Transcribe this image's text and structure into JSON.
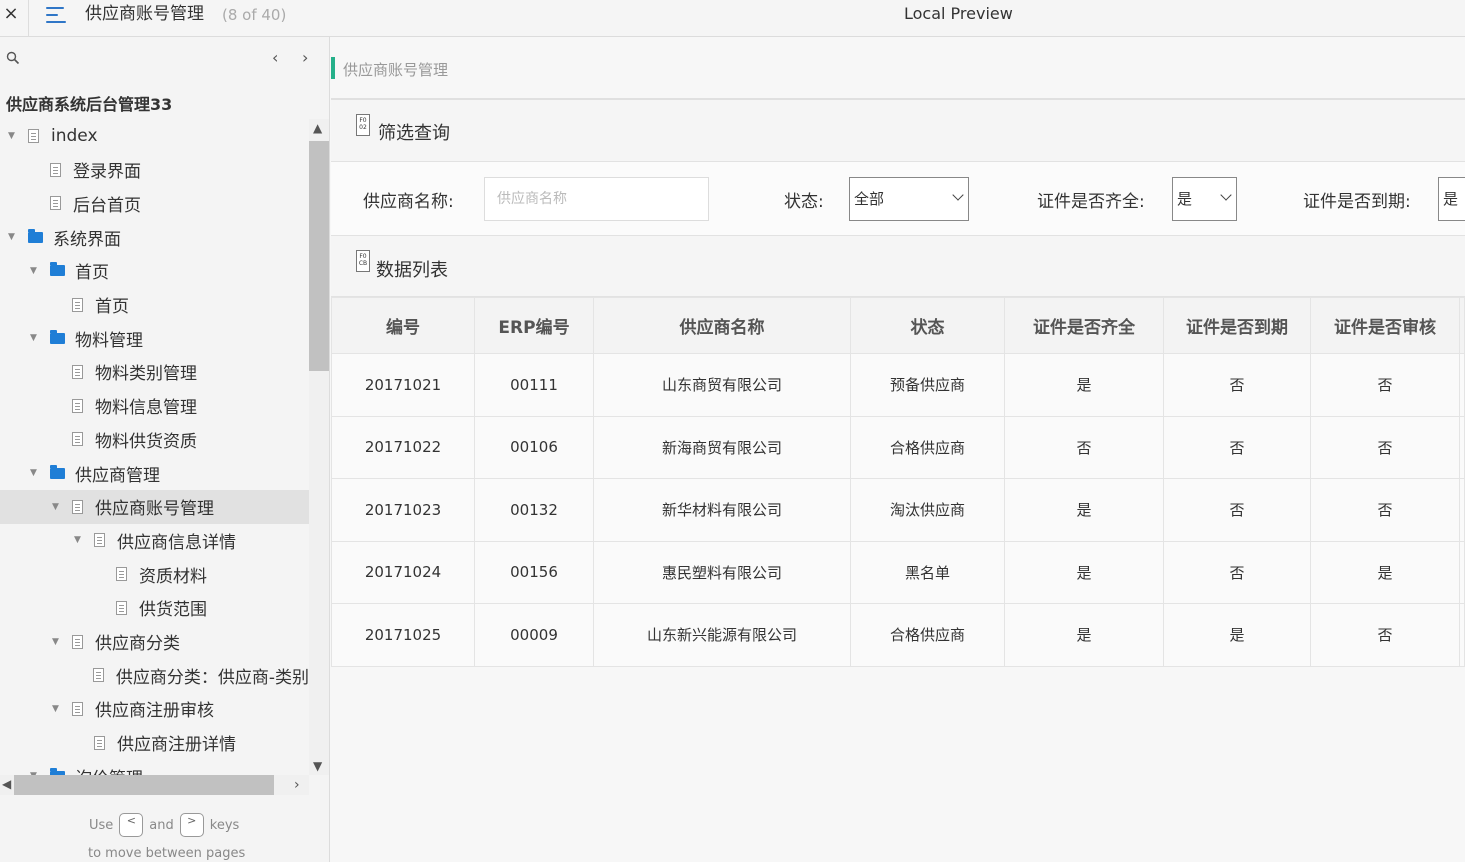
{
  "topbar": {
    "close_icon": "×",
    "page_title": "供应商账号管理",
    "page_count": "(8 of 40)",
    "preview_title": "Local Preview"
  },
  "sidebar": {
    "project_title": "供应商系统后台管理33",
    "tree": [
      {
        "label": "index",
        "type": "page",
        "level": 0,
        "expanded": true
      },
      {
        "label": "登录界面",
        "type": "page",
        "level": 1
      },
      {
        "label": "后台首页",
        "type": "page",
        "level": 1
      },
      {
        "label": "系统界面",
        "type": "folder",
        "level": 0,
        "expanded": true
      },
      {
        "label": "首页",
        "type": "folder",
        "level": 1,
        "expanded": true
      },
      {
        "label": "首页",
        "type": "page",
        "level": 2
      },
      {
        "label": "物料管理",
        "type": "folder",
        "level": 1,
        "expanded": true
      },
      {
        "label": "物料类别管理",
        "type": "page",
        "level": 2
      },
      {
        "label": "物料信息管理",
        "type": "page",
        "level": 2
      },
      {
        "label": "物料供货资质",
        "type": "page",
        "level": 2
      },
      {
        "label": "供应商管理",
        "type": "folder",
        "level": 1,
        "expanded": true
      },
      {
        "label": "供应商账号管理",
        "type": "page",
        "level": 2,
        "expanded": true,
        "selected": true
      },
      {
        "label": "供应商信息详情",
        "type": "page",
        "level": 3,
        "expanded": true
      },
      {
        "label": "资质材料",
        "type": "page",
        "level": 4
      },
      {
        "label": "供货范围",
        "type": "page",
        "level": 4
      },
      {
        "label": "供应商分类",
        "type": "page",
        "level": 2,
        "expanded": true
      },
      {
        "label": "供应商分类：供应商-类别",
        "type": "page",
        "level": 3
      },
      {
        "label": "供应商注册审核",
        "type": "page",
        "level": 2,
        "expanded": true
      },
      {
        "label": "供应商注册详情",
        "type": "page",
        "level": 3
      },
      {
        "label": "询价管理",
        "type": "folder",
        "level": 1,
        "expanded": true
      }
    ],
    "keys_hint": {
      "use": "Use",
      "prev_key": "<",
      "and": "and",
      "next_key": ">",
      "keys": "keys",
      "line2": "to move between pages"
    }
  },
  "main": {
    "breadcrumb": "供应商账号管理",
    "filter_section": {
      "icon_text": "F0 02",
      "title": "筛选查询"
    },
    "filters": {
      "name_label": "供应商名称:",
      "name_placeholder": "供应商名称",
      "status_label": "状态:",
      "status_value": "全部",
      "cert_complete_label": "证件是否齐全:",
      "cert_complete_value": "是",
      "cert_expired_label": "证件是否到期:",
      "cert_expired_value": "是"
    },
    "list_section": {
      "icon_text": "F0 CB",
      "title": "数据列表"
    },
    "table": {
      "columns": [
        "编号",
        "ERP编号",
        "供应商名称",
        "状态",
        "证件是否齐全",
        "证件是否到期",
        "证件是否审核"
      ],
      "rows": [
        [
          "20171021",
          "00111",
          "山东商贸有限公司",
          "预备供应商",
          "是",
          "否",
          "否"
        ],
        [
          "20171022",
          "00106",
          "新海商贸有限公司",
          "合格供应商",
          "否",
          "否",
          "否"
        ],
        [
          "20171023",
          "00132",
          "新华材料有限公司",
          "淘汰供应商",
          "是",
          "否",
          "否"
        ],
        [
          "20171024",
          "00156",
          "惠民塑料有限公司",
          "黑名单",
          "是",
          "否",
          "是"
        ],
        [
          "20171025",
          "00009",
          "山东新兴能源有限公司",
          "合格供应商",
          "是",
          "是",
          "否"
        ]
      ]
    }
  },
  "colors": {
    "accent_blue": "#2f76c7",
    "folder_blue": "#1f7ed6",
    "breadcrumb_marker": "#25b08a"
  }
}
